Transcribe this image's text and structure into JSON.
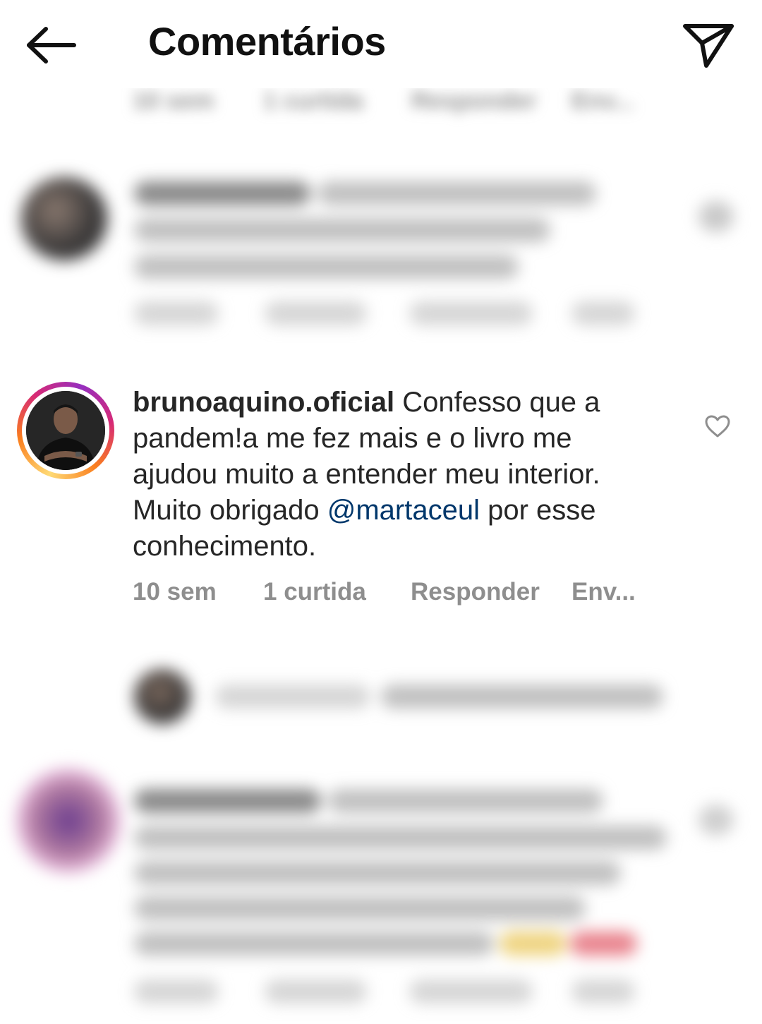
{
  "header": {
    "title": "Comentários",
    "back_icon": "arrow-left-icon",
    "share_icon": "paper-plane-icon"
  },
  "comment": {
    "username": "brunoaquino.oficial",
    "text_before_mention": "Confesso que a pandem!a me fez mais e o livro me ajudou muito a entender meu interior. Muito obrigado",
    "mention": "@martaceul",
    "text_after_mention": "por esse conhecimento.",
    "time": "10 sem",
    "likes": "1 curtida",
    "reply": "Responder",
    "send": "Env...",
    "like_icon": "heart-outline-icon"
  },
  "blurred_meta_top": {
    "time": "10 sem",
    "likes": "1 curtida",
    "reply": "Responder",
    "send": "Env..."
  },
  "colors": {
    "text": "#262626",
    "secondary": "#8e8e8e",
    "mention": "#00376b",
    "story_ring": [
      "#feda75",
      "#fa7e1e",
      "#d62976",
      "#962fbf"
    ]
  }
}
